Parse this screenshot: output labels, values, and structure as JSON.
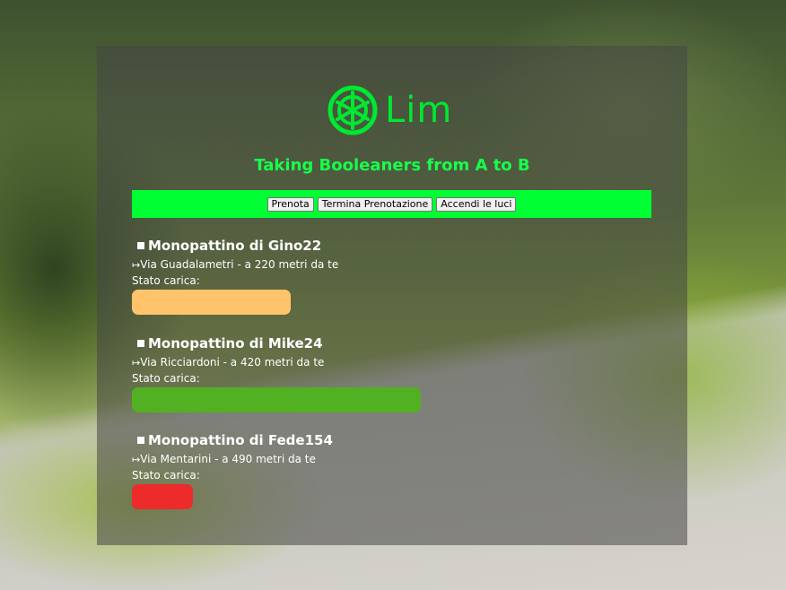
{
  "brand": {
    "logo_text": "Lim",
    "logo_color": "#00e832",
    "tagline": "Taking Booleaners from A to B"
  },
  "toolbar": {
    "color": "#00ff33",
    "buttons": [
      {
        "label": "Prenota"
      },
      {
        "label": "Termina Prenotazione"
      },
      {
        "label": "Accendi le luci"
      }
    ]
  },
  "scooters": [
    {
      "title": "Monopattino di Gino22",
      "address": "Via Guadalametri - a 220 metri da te",
      "status_label": "Stato carica:",
      "charge_fraction": 0.55,
      "charge_color": "#ffc46b"
    },
    {
      "title": "Monopattino di Mike24",
      "address": "Via Ricciardoni - a 420 metri da te",
      "status_label": "Stato carica:",
      "charge_fraction": 1.0,
      "charge_color": "#52b023"
    },
    {
      "title": "Monopattino di Fede154",
      "address": "Via Mentarini - a 490 metri da te",
      "status_label": "Stato carica:",
      "charge_fraction": 0.21,
      "charge_color": "#ee2b2b"
    }
  ]
}
